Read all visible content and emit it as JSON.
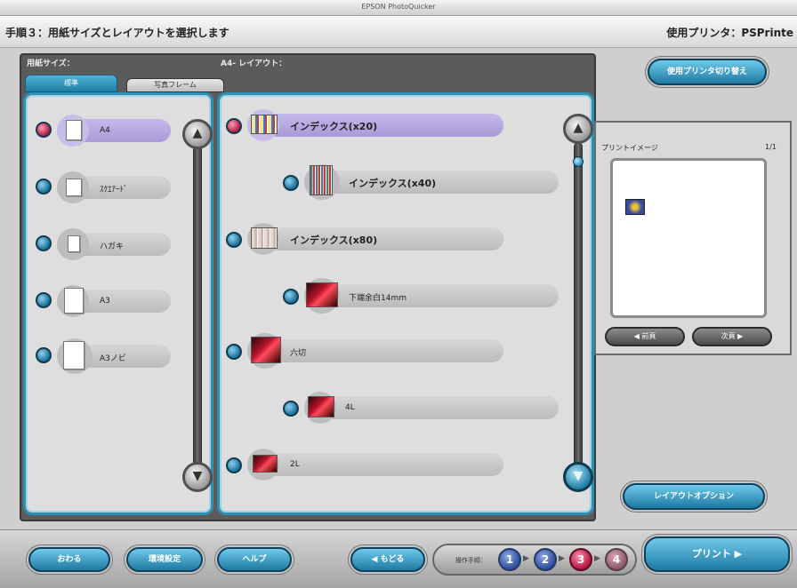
{
  "window": {
    "title": "EPSON PhotoQuicker"
  },
  "header": {
    "step_title": "手順３：用紙サイズとレイアウトを選択します",
    "printer_label": "使用プリンタ：PSPrinte"
  },
  "paper_size": {
    "section_label": "用紙サイズ：",
    "tabs": [
      {
        "label": "標準"
      },
      {
        "label": "写真フレーム"
      }
    ],
    "items": [
      {
        "label": "A4",
        "selected": true
      },
      {
        "label": "ｽｸｴｱｰﾄﾞ",
        "selected": false
      },
      {
        "label": "ハガキ",
        "selected": false
      },
      {
        "label": "A3",
        "selected": false
      },
      {
        "label": "A3ノビ",
        "selected": false
      }
    ]
  },
  "layout": {
    "section_label": "A4- レイアウト：",
    "items": [
      {
        "label": "インデックス(x20)",
        "selected": true,
        "thumb": "index-icon"
      },
      {
        "label": "インデックス(x40)",
        "selected": false,
        "thumb": "index-dense-icon"
      },
      {
        "label": "インデックス(x80)",
        "selected": false,
        "thumb": "index-light-icon"
      },
      {
        "label": "下端余白14mm",
        "selected": false,
        "thumb": "photo-icon"
      },
      {
        "label": "六切",
        "selected": false,
        "thumb": "photo-icon"
      },
      {
        "label": "4L",
        "selected": false,
        "thumb": "photo-icon"
      },
      {
        "label": "2L",
        "selected": false,
        "thumb": "photo-icon"
      }
    ]
  },
  "preview": {
    "switch_printer_button": "使用プリンタ切り替え",
    "print_image_label": "プリントイメージ",
    "page_count": "1/1",
    "prev_button": "前頁",
    "next_button": "次頁",
    "layout_option_button": "レイアウトオプション"
  },
  "footer": {
    "exit_button": "おわる",
    "env_settings_button": "環境設定",
    "help_button": "ヘルプ",
    "back_button": "もどる",
    "steps_label": "操作手順：",
    "steps": [
      "1",
      "2",
      "3",
      "4"
    ],
    "current_step": 3,
    "print_button": "プリント"
  },
  "colors": {
    "accent_blue": "#2e8fb5",
    "selected_pill": "#b3a6e0",
    "panel_bg": "#dedede",
    "active_step": "#b3163f"
  }
}
